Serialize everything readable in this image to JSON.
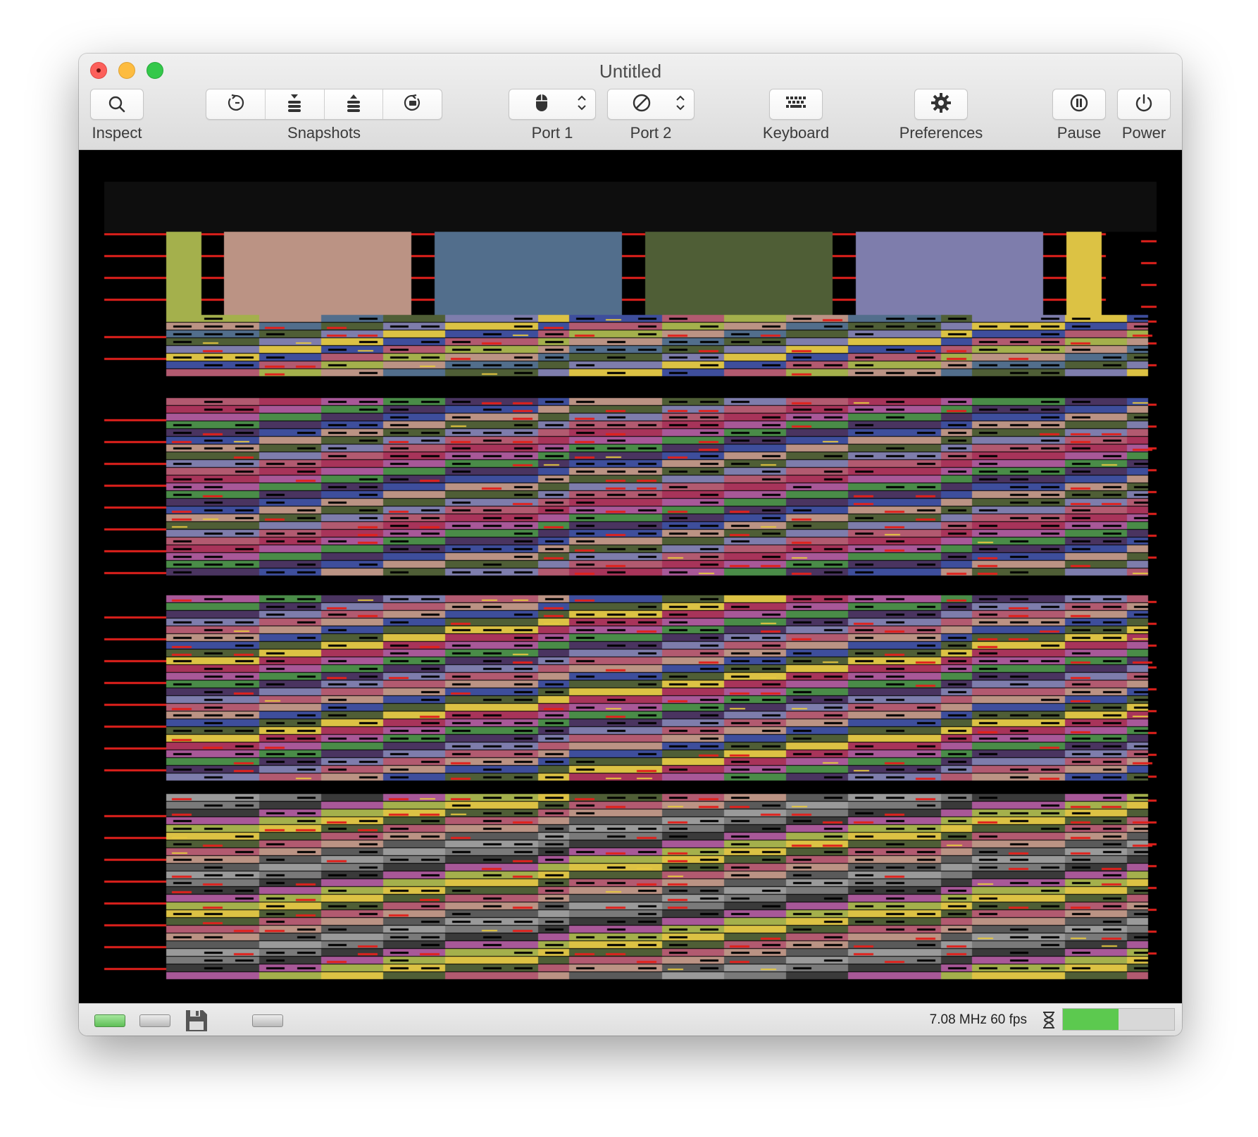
{
  "window": {
    "title": "Untitled"
  },
  "toolbar": {
    "inspect_label": "Inspect",
    "snapshots_label": "Snapshots",
    "port1_label": "Port 1",
    "port2_label": "Port 2",
    "keyboard_label": "Keyboard",
    "preferences_label": "Preferences",
    "pause_label": "Pause",
    "power_label": "Power",
    "icons": {
      "inspect": "magnifier-icon",
      "snapshots": [
        "take-snapshot-icon",
        "push-snapshot-icon",
        "pop-snapshot-icon",
        "restore-snapshot-icon"
      ],
      "port1": "mouse-icon",
      "port2": "no-device-icon",
      "keyboard": "keyboard-icon",
      "preferences": "gear-icon",
      "pause": "pause-icon",
      "power": "power-icon"
    }
  },
  "status": {
    "speed_text": "7.08 MHz 60 fps",
    "drive_states": [
      "on",
      "off",
      "floppy",
      "off"
    ],
    "performance_fraction": 0.5
  },
  "colors": {
    "bars": [
      "#a4b04c",
      "#bb9384",
      "#526e8c",
      "#4f5e36",
      "#7e7dac",
      "#dcc244"
    ],
    "palette": [
      "#a4b04c",
      "#bb9384",
      "#526e8c",
      "#4f5e36",
      "#7e7dac",
      "#dcc244",
      "#3e4e9c",
      "#b25a70",
      "#a8345a",
      "#a85898",
      "#4a8c48",
      "#4a3460",
      "#5a5a5a",
      "#9a9a9a",
      "#7a7a7a",
      "#3a3a3a"
    ],
    "red_line": "#e0211c"
  }
}
